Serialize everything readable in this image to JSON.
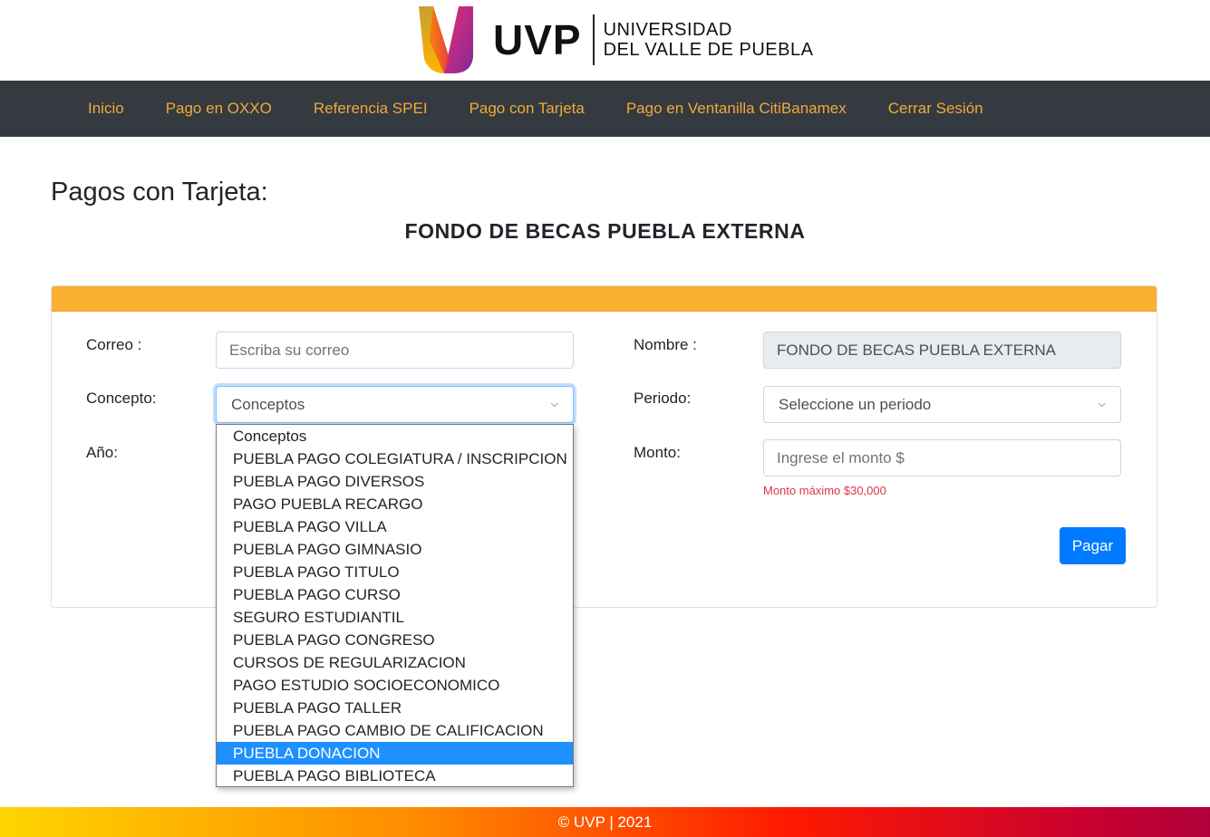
{
  "brand": {
    "logo_text": "UVP",
    "name_line1": "UNIVERSIDAD",
    "name_line2": "DEL VALLE DE PUEBLA"
  },
  "nav": {
    "items": [
      {
        "label": "Inicio"
      },
      {
        "label": "Pago en OXXO"
      },
      {
        "label": "Referencia SPEI"
      },
      {
        "label": "Pago con Tarjeta"
      },
      {
        "label": "Pago en Ventanilla CitiBanamex"
      },
      {
        "label": "Cerrar Sesión"
      }
    ]
  },
  "page": {
    "title": "Pagos con Tarjeta:",
    "subtitle": "FONDO DE BECAS PUEBLA EXTERNA"
  },
  "form": {
    "correo_label": "Correo :",
    "correo_placeholder": "Escriba su correo",
    "concepto_label": "Concepto:",
    "concepto_value": "Conceptos",
    "anio_label": "Año:",
    "nombre_label": "Nombre :",
    "nombre_value": "FONDO DE BECAS  PUEBLA EXTERNA",
    "periodo_label": "Periodo:",
    "periodo_value": "Seleccione un periodo",
    "monto_label": "Monto:",
    "monto_placeholder": "Ingrese el monto $",
    "monto_hint": "Monto máximo $30,000",
    "submit_label": "Pagar"
  },
  "concepto_options": [
    "Conceptos",
    "PUEBLA PAGO COLEGIATURA / INSCRIPCION",
    "PUEBLA PAGO DIVERSOS",
    "PAGO PUEBLA RECARGO",
    "PUEBLA PAGO VILLA",
    "PUEBLA PAGO GIMNASIO",
    "PUEBLA PAGO TITULO",
    "PUEBLA PAGO CURSO",
    "SEGURO ESTUDIANTIL",
    "PUEBLA PAGO CONGRESO",
    "CURSOS DE REGULARIZACION",
    "PAGO ESTUDIO SOCIOECONOMICO",
    "PUEBLA PAGO TALLER",
    "PUEBLA PAGO CAMBIO DE CALIFICACION",
    "PUEBLA DONACION",
    "PUEBLA PAGO BIBLIOTECA"
  ],
  "highlighted_option": "PUEBLA DONACION",
  "footer": {
    "text": "© UVP | 2021"
  },
  "colors": {
    "nav_bg": "#343a40",
    "nav_link": "#f0a93a",
    "card_header": "#fbb034",
    "primary": "#007bff",
    "highlight": "#1e90ff",
    "danger": "#dc3545"
  }
}
